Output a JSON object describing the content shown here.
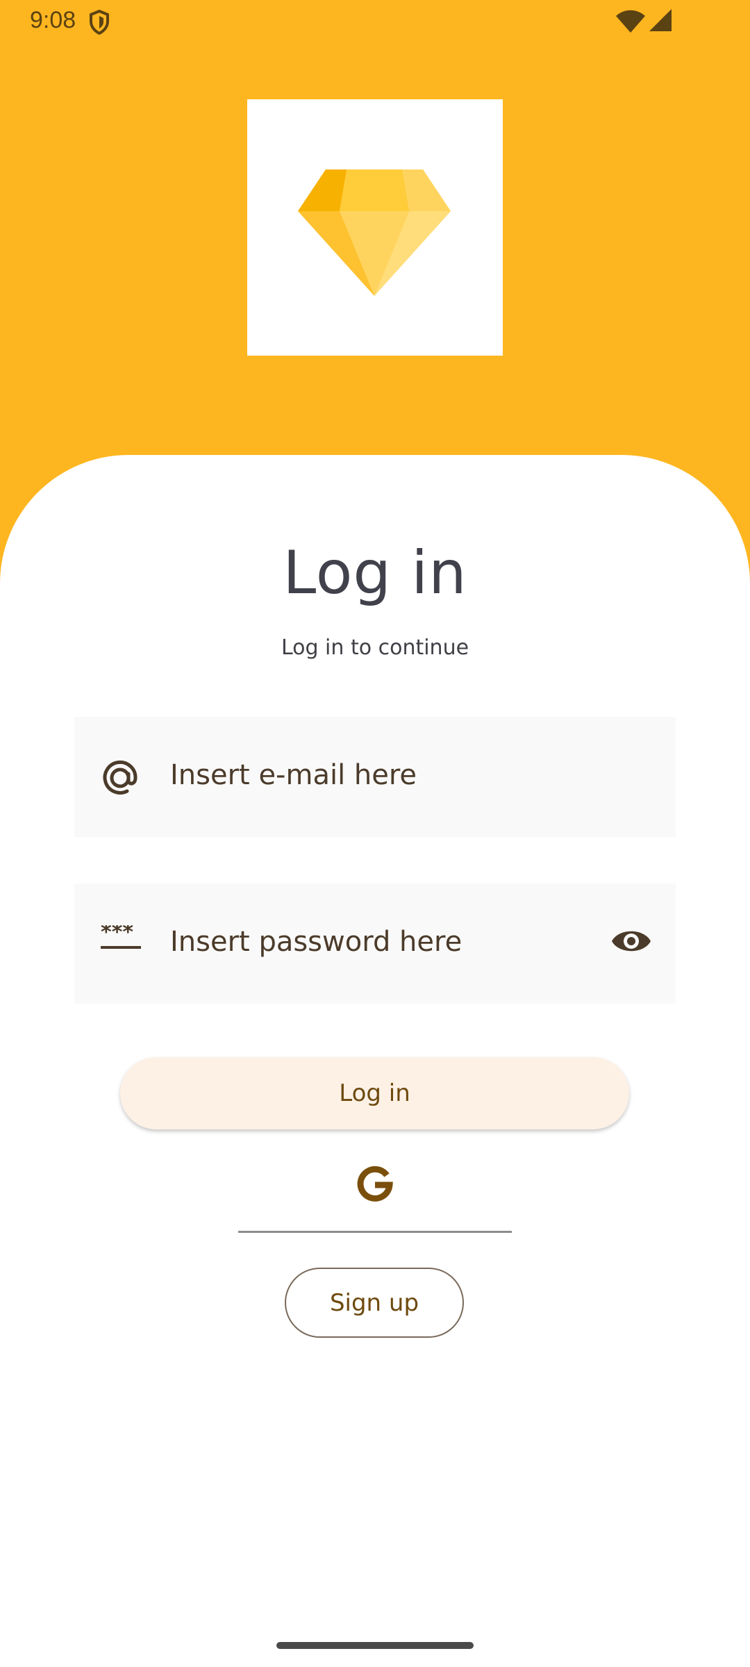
{
  "status_bar": {
    "time": "9:08"
  },
  "header": {
    "logo_icon": "diamond-icon"
  },
  "login": {
    "title": "Log in",
    "subtitle": "Log in to continue",
    "email_placeholder": "Insert e-mail here",
    "password_placeholder": "Insert password here",
    "login_button_label": "Log in",
    "signup_button_label": "Sign up"
  },
  "icons": {
    "email": "at-sign-icon",
    "password": "password-dots-icon",
    "visibility": "eye-icon",
    "google": "google-icon"
  },
  "colors": {
    "header_background": "#FEB620",
    "field_background": "#F9F9F9",
    "login_button_background": "#FDF1E6",
    "accent_text": "#6E4A0F"
  }
}
